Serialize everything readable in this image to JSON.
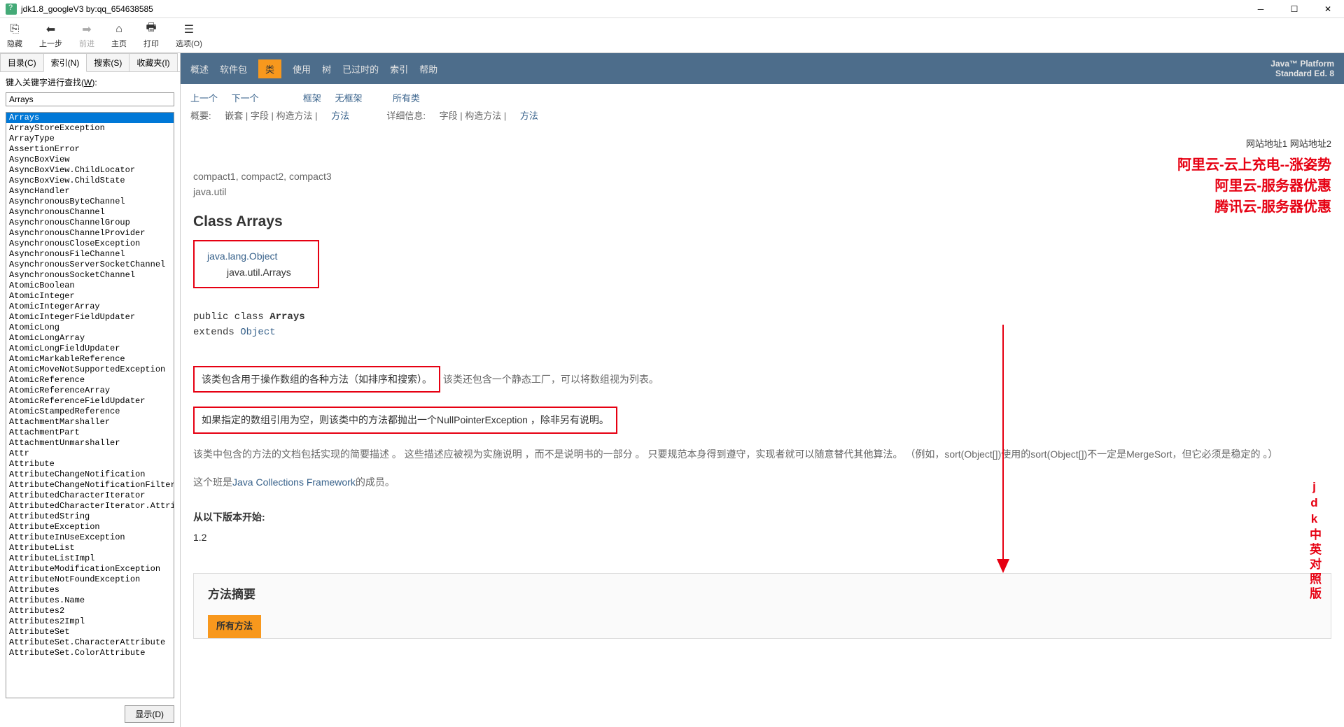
{
  "window": {
    "title": "jdk1.8_googleV3 by:qq_654638585"
  },
  "toolbar": {
    "hide": "隐藏",
    "back": "上一步",
    "forward": "前进",
    "home": "主页",
    "print": "打印",
    "options": "选项(O)"
  },
  "sidebar": {
    "tabs": {
      "contents": "目录(C)",
      "index": "索引(N)",
      "search": "搜索(S)",
      "favorites": "收藏夹(I)"
    },
    "search_label_pre": "键入关键字进行查找(",
    "search_label_u": "W",
    "search_label_post": "):",
    "search_value": "Arrays",
    "items": [
      "Arrays",
      "ArrayStoreException",
      "ArrayType",
      "AssertionError",
      "AsyncBoxView",
      "AsyncBoxView.ChildLocator",
      "AsyncBoxView.ChildState",
      "AsyncHandler",
      "AsynchronousByteChannel",
      "AsynchronousChannel",
      "AsynchronousChannelGroup",
      "AsynchronousChannelProvider",
      "AsynchronousCloseException",
      "AsynchronousFileChannel",
      "AsynchronousServerSocketChannel",
      "AsynchronousSocketChannel",
      "AtomicBoolean",
      "AtomicInteger",
      "AtomicIntegerArray",
      "AtomicIntegerFieldUpdater",
      "AtomicLong",
      "AtomicLongArray",
      "AtomicLongFieldUpdater",
      "AtomicMarkableReference",
      "AtomicMoveNotSupportedException",
      "AtomicReference",
      "AtomicReferenceArray",
      "AtomicReferenceFieldUpdater",
      "AtomicStampedReference",
      "AttachmentMarshaller",
      "AttachmentPart",
      "AttachmentUnmarshaller",
      "Attr",
      "Attribute",
      "AttributeChangeNotification",
      "AttributeChangeNotificationFilter",
      "AttributedCharacterIterator",
      "AttributedCharacterIterator.Attribu",
      "AttributedString",
      "AttributeException",
      "AttributeInUseException",
      "AttributeList",
      "AttributeListImpl",
      "AttributeModificationException",
      "AttributeNotFoundException",
      "Attributes",
      "Attributes.Name",
      "Attributes2",
      "Attributes2Impl",
      "AttributeSet",
      "AttributeSet.CharacterAttribute",
      "AttributeSet.ColorAttribute"
    ],
    "show_btn": "显示(D)"
  },
  "nav1": {
    "items": [
      "概述",
      "软件包",
      "类",
      "使用",
      "树",
      "已过时的",
      "索引",
      "帮助"
    ],
    "brand1": "Java™ Platform",
    "brand2": "Standard Ed. 8"
  },
  "nav2": {
    "row1": {
      "prev": "上一个",
      "next": "下一个",
      "frame": "框架",
      "noframe": "无框架",
      "all": "所有类"
    },
    "row2": {
      "summary": "概要:",
      "nested": "嵌套",
      "field": "字段",
      "constr": "构造方法",
      "method": "方法",
      "detail": "详细信息:",
      "d_field": "字段",
      "d_constr": "构造方法",
      "d_method": "方法"
    }
  },
  "doc": {
    "addr1": "网站地址1",
    "addr2": "网站地址2",
    "promo1": "阿里云-云上充电--涨姿势",
    "promo2": "阿里云-服务器优惠",
    "promo3": "腾讯云-服务器优惠",
    "compact": "compact1, compact2, compact3",
    "pkg": "java.util",
    "class_title": "Class Arrays",
    "inherit1": "java.lang.Object",
    "inherit2": "java.util.Arrays",
    "sig_line1a": "public class ",
    "sig_line1b": "Arrays",
    "sig_line2a": "extends ",
    "sig_line2b": "Object",
    "desc1_box": "该类包含用于操作数组的各种方法（如排序和搜索）。",
    "desc1_after": "该类还包含一个静态工厂，可以将数组视为列表。",
    "desc2_box": "如果指定的数组引用为空，则该类中的方法都抛出一个NullPointerException ，除非另有说明。",
    "desc3": "该类中包含的方法的文档包括实现的简要描述 。 这些描述应被视为实施说明 ，而不是说明书的一部分 。 只要规范本身得到遵守，实现者就可以随意替代其他算法。 （例如，sort(Object[])使用的sort(Object[])不一定是MergeSort，但它必须是稳定的 。）",
    "desc4a": "这个班是",
    "desc4b": "Java Collections Framework",
    "desc4c": "的成员。",
    "since_label": "从以下版本开始:",
    "since_val": "1.2",
    "method_summary": "方法摘要",
    "all_methods": "所有方法",
    "vertical": "jdk中英对照版"
  }
}
